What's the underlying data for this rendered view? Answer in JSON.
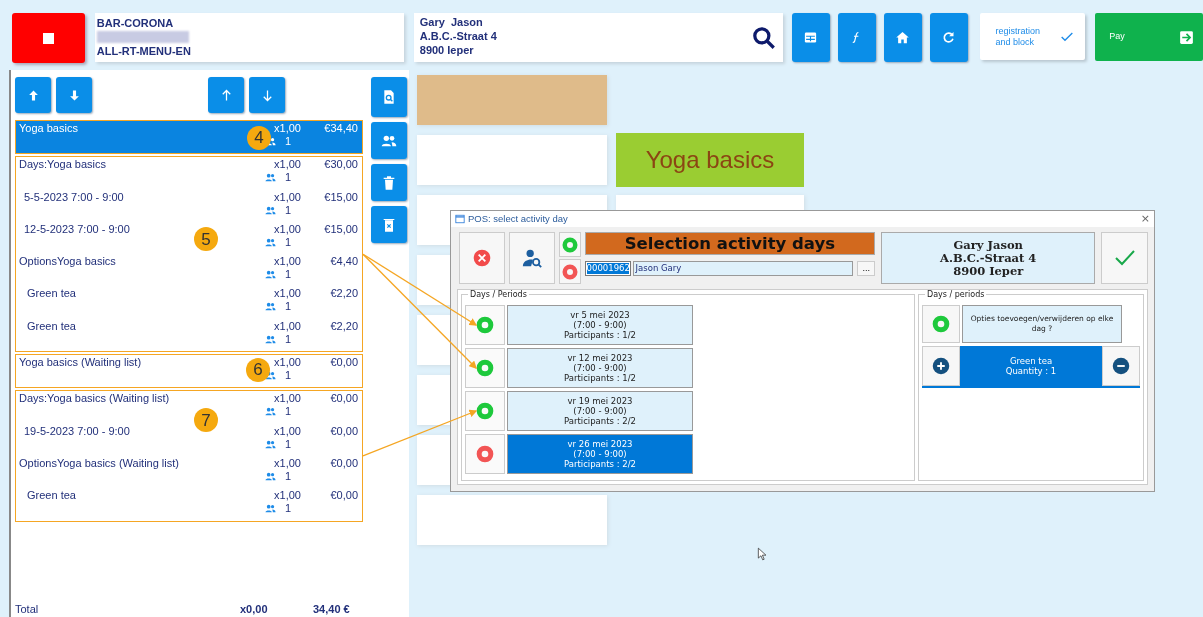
{
  "header": {
    "store_name": "BAR-CORONA",
    "menu_name": "ALL-RT-MENU-EN",
    "customer_lines": [
      "Gary  Jason",
      "A.B.C.-Straat 4",
      "8900 Ieper"
    ],
    "registration_button": "registration and block",
    "pay_button": "Pay"
  },
  "order": {
    "groups": [
      {
        "marker": "4",
        "lines": [
          {
            "kind": "main",
            "name": "Yoga basics",
            "qty": "x1,00",
            "price": "€34,40",
            "people": "1",
            "selected": true
          }
        ]
      },
      {
        "marker": "5",
        "lines": [
          {
            "kind": "main",
            "name": "Days:Yoga basics",
            "qty": "x1,00",
            "price": "€30,00",
            "people": "1",
            "selected": false
          },
          {
            "kind": "sub",
            "name": "5-5-2023 7:00 - 9:00",
            "qty": "x1,00",
            "price": "€15,00",
            "people": "1",
            "selected": false
          },
          {
            "kind": "sub",
            "name": "12-5-2023 7:00 - 9:00",
            "qty": "x1,00",
            "price": "€15,00",
            "people": "1",
            "selected": false
          },
          {
            "kind": "main",
            "name": "OptionsYoga basics",
            "qty": "x1,00",
            "price": "€4,40",
            "people": "1",
            "selected": false
          },
          {
            "kind": "sub",
            "name": "Green tea",
            "qty": "x1,00",
            "price": "€2,20",
            "people": "1",
            "selected": false
          },
          {
            "kind": "sub",
            "name": "Green tea",
            "qty": "x1,00",
            "price": "€2,20",
            "people": "1",
            "selected": false
          }
        ]
      },
      {
        "marker": "6",
        "lines": [
          {
            "kind": "main",
            "name": "Yoga basics (Waiting list)",
            "qty": "x1,00",
            "price": "€0,00",
            "people": "1",
            "selected": false
          }
        ]
      },
      {
        "marker": "7",
        "lines": [
          {
            "kind": "main",
            "name": "Days:Yoga basics (Waiting list)",
            "qty": "x1,00",
            "price": "€0,00",
            "people": "1",
            "selected": false
          },
          {
            "kind": "sub",
            "name": "19-5-2023 7:00 - 9:00",
            "qty": "x1,00",
            "price": "€0,00",
            "people": "1",
            "selected": false
          },
          {
            "kind": "main",
            "name": "OptionsYoga basics (Waiting list)",
            "qty": "x1,00",
            "price": "€0,00",
            "people": "1",
            "selected": false
          },
          {
            "kind": "sub",
            "name": "Green tea",
            "qty": "x1,00",
            "price": "€0,00",
            "people": "1",
            "selected": false
          }
        ]
      }
    ],
    "total": {
      "label": "Total",
      "qty": "x0,00",
      "amount": "34,40 €"
    }
  },
  "featured_tile": "Yoga basics",
  "dialog": {
    "title": "POS: select activity day",
    "close_button": "×",
    "heading": "Selection activity days",
    "customer_id": "00001962",
    "customer_name": "Jason Gary",
    "browse_button": "...",
    "customer_card": [
      "Gary Jason",
      "A.B.C.-Straat 4",
      "8900 Ieper"
    ],
    "days_legend": "Days / Periods",
    "days": [
      {
        "lines": [
          "vr 5 mei 2023",
          "(7:00 - 9:00)",
          "Participants : 1/2"
        ],
        "selected": false
      },
      {
        "lines": [
          "vr 12 mei 2023",
          "(7:00 - 9:00)",
          "Participants : 1/2"
        ],
        "selected": false
      },
      {
        "lines": [
          "vr 19 mei 2023",
          "(7:00 - 9:00)",
          "Participants : 2/2"
        ],
        "selected": false
      },
      {
        "lines": [
          "vr 26 mei 2023",
          "(7:00 - 9:00)",
          "Participants : 2/2"
        ],
        "selected": true
      }
    ],
    "options_legend": "Days / periods",
    "options_prompt": "Opties toevoegen/verwijderen op elke dag ?",
    "options": [
      {
        "name": "Green tea",
        "quantity": "Quantity : 1",
        "selected": true
      }
    ]
  }
}
